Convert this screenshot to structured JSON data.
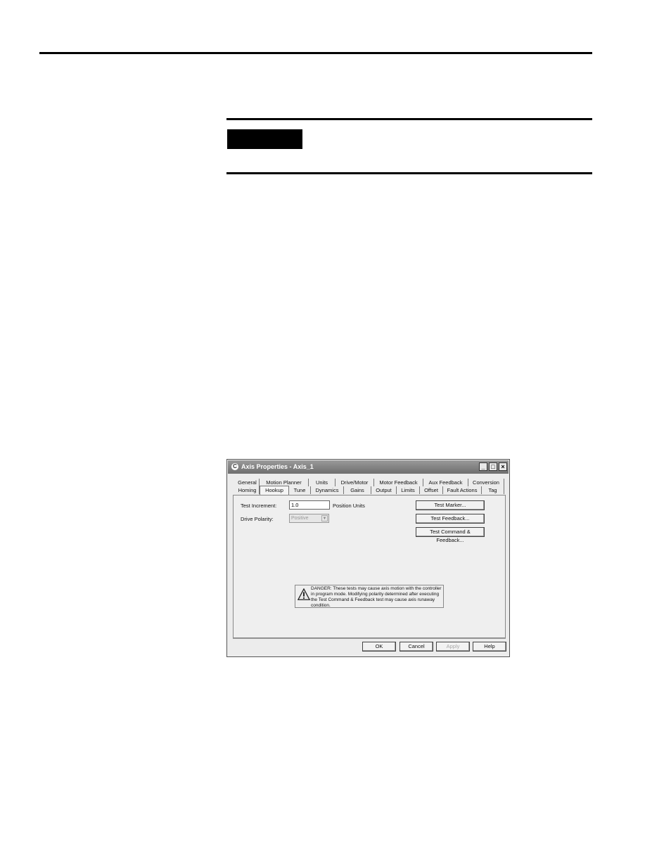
{
  "dialog": {
    "title": "Axis Properties - Axis_1",
    "window_buttons": [
      "_",
      "□",
      "×"
    ],
    "tabs_row1": [
      "General",
      "Motion Planner",
      "Units",
      "Drive/Motor",
      "Motor Feedback",
      "Aux Feedback",
      "Conversion"
    ],
    "tabs_row2": [
      "Homing",
      "Hookup",
      "Tune",
      "Dynamics",
      "Gains",
      "Output",
      "Limits",
      "Offset",
      "Fault Actions",
      "Tag"
    ],
    "active_tab": "Hookup",
    "test_increment_label": "Test Increment:",
    "test_increment_value": "1.0",
    "test_increment_units": "Position Units",
    "drive_polarity_label": "Drive Polarity:",
    "drive_polarity_value": "Positive",
    "buttons": {
      "test_marker": "Test Marker...",
      "test_feedback": "Test Feedback...",
      "test_command_feedback": "Test Command & Feedback..."
    },
    "danger_text": "DANGER: These tests may cause axis motion with the controller in program mode. Modifying polarity determined after executing the Test Command & Feedback test may cause axis runaway condition.",
    "footer": {
      "ok": "OK",
      "cancel": "Cancel",
      "apply": "Apply",
      "help": "Help"
    }
  }
}
